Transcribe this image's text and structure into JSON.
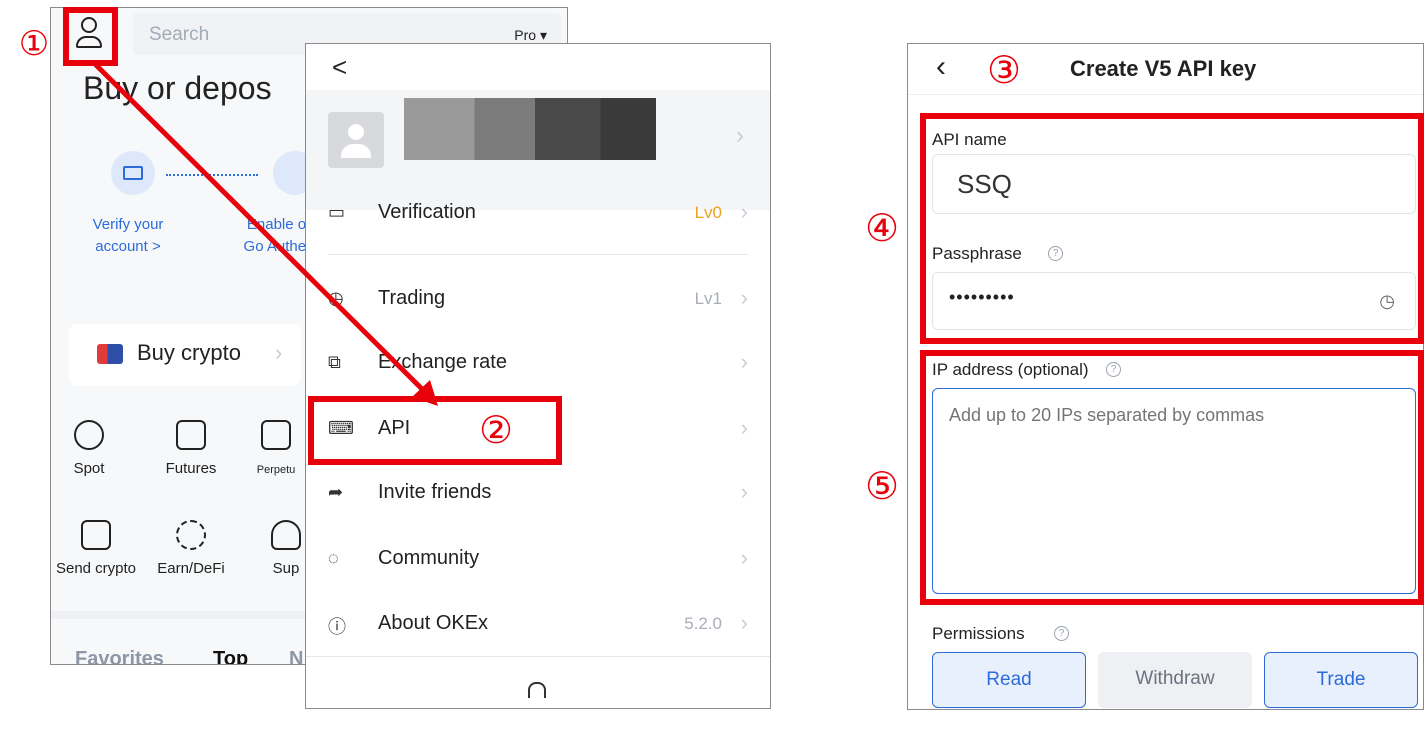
{
  "left": {
    "search_placeholder": "Search",
    "pro_label": "Pro ▾",
    "heading": "Buy or depos",
    "verify_label": "Verify your account >",
    "enable_label": "Enable or Go Authen",
    "buy_crypto": "Buy crypto",
    "grid": [
      {
        "label": "Spot",
        "icon": "spot-icon"
      },
      {
        "label": "Futures",
        "icon": "futures-icon"
      },
      {
        "label": "Perpetu",
        "icon": "perpetual-icon"
      },
      {
        "label": "Send crypto",
        "icon": "send-crypto-icon"
      },
      {
        "label": "Earn/DeFi",
        "icon": "earn-icon"
      },
      {
        "label": "Sup",
        "icon": "support-icon"
      }
    ],
    "tabs": [
      "Favorites",
      "Top",
      "N"
    ]
  },
  "menu": {
    "back": "<",
    "items": [
      {
        "label": "Verification",
        "value": "Lv0",
        "icon": "id-card-icon",
        "value_color": "#f0a020"
      },
      {
        "label": "Trading",
        "value": "Lv1",
        "icon": "trading-icon"
      },
      {
        "label": "Exchange rate",
        "value": "",
        "icon": "exchange-rate-icon"
      },
      {
        "label": "API",
        "value": "",
        "icon": "api-icon"
      },
      {
        "label": "Invite friends",
        "value": "",
        "icon": "share-icon"
      },
      {
        "label": "Community",
        "value": "",
        "icon": "community-icon"
      },
      {
        "label": "About OKEx",
        "value": "5.2.0",
        "icon": "info-icon"
      }
    ]
  },
  "right": {
    "title": "Create V5 API key",
    "api_name_label": "API name",
    "api_name_value": "SSQ",
    "passphrase_label": "Passphrase",
    "passphrase_value": "•••••••••",
    "ip_label": "IP address (optional)",
    "ip_placeholder": "Add up to 20 IPs separated by commas",
    "permissions_label": "Permissions",
    "buttons": [
      "Read",
      "Withdraw",
      "Trade"
    ]
  },
  "annotations": [
    "①",
    "②",
    "③",
    "④",
    "⑤"
  ],
  "colors": {
    "accent": "#e8000b",
    "brand_blue": "#2d6bd9",
    "lv0": "#f0a020"
  }
}
